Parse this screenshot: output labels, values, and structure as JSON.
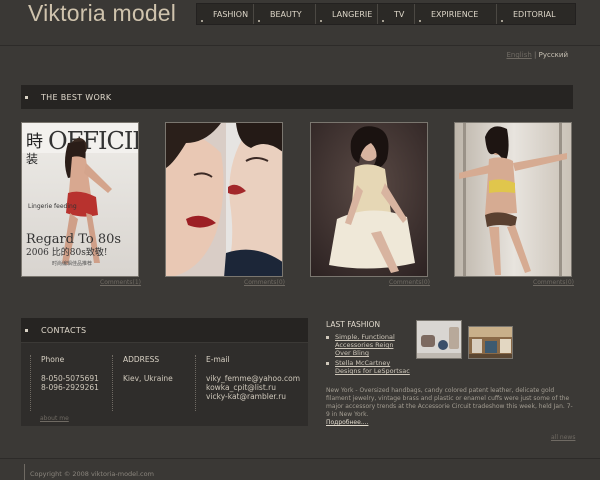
{
  "site": {
    "logo": "Viktoria model"
  },
  "nav": [
    {
      "label": "FASHION"
    },
    {
      "label": "BEAUTY"
    },
    {
      "label": "LANGERIE"
    },
    {
      "label": "TV"
    },
    {
      "label": "EXPIRIENCE"
    },
    {
      "label": "EDITORIAL"
    }
  ],
  "lang": {
    "en": "English",
    "sep": "|",
    "ru": "Русский"
  },
  "best_work": {
    "title": "THE BEST WORK",
    "items": [
      {
        "comments": "Comments(1)"
      },
      {
        "comments": "Comments(0)"
      },
      {
        "comments": "Comments(0)"
      },
      {
        "comments": "Comments(0)"
      }
    ]
  },
  "contacts": {
    "title": "CONTACTS",
    "phone": {
      "head": "Phone",
      "lines": [
        "8-050-5075691",
        "8-096-2929261"
      ]
    },
    "address": {
      "head": "ADDRESS",
      "lines": [
        "Kiev, Ukraine"
      ]
    },
    "email": {
      "head": "E-mail",
      "lines": [
        "viky_femme@yahoo.com",
        "kowka_cpit@list.ru",
        "vicky-kat@rambler.ru"
      ]
    },
    "about": "about me"
  },
  "last_fashion": {
    "title": "LAST FASHION",
    "items": [
      {
        "label": "Simple, Functional Accessories Reign Over Bling"
      },
      {
        "label": "Stella McCartney Designs for LeSportsac"
      }
    ],
    "text": "New York - Oversized handbags, candy colored patent leather, delicate gold filament jewelry, vintage brass and plastic or enamel cuffs were just some of the major accessory trends at the Accessorie Circuit tradeshow this week, held Jan. 7-9 in New York.",
    "more": "Подробнее....",
    "all_news": "all news"
  },
  "footer": {
    "copyright": "Copyright © 2008 viktoria-model.com"
  },
  "colors": {
    "background": "#3b3936",
    "panel": "#262422",
    "text": "#d6d1c6"
  }
}
